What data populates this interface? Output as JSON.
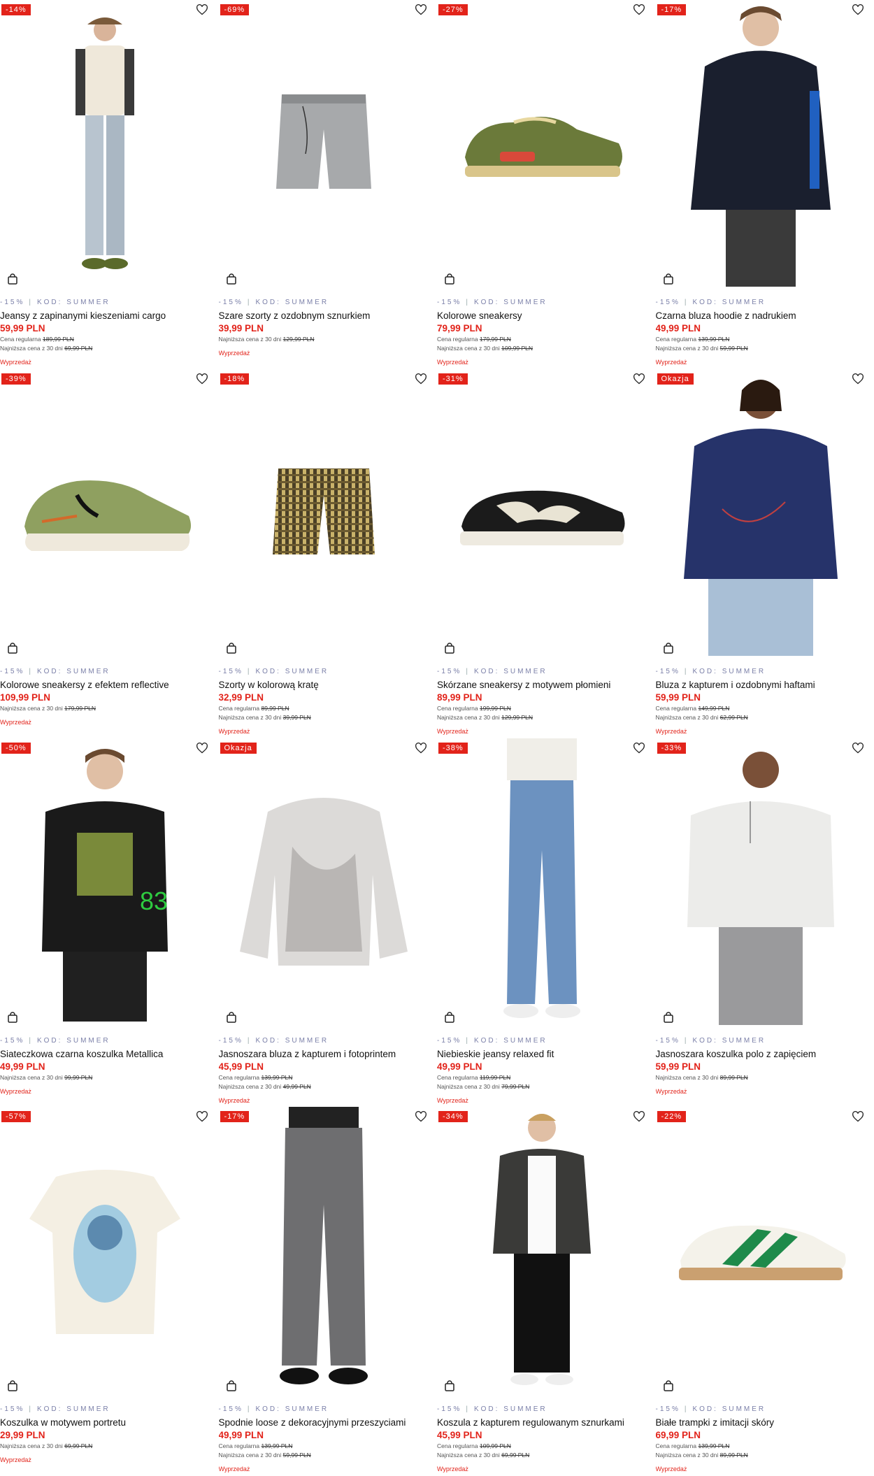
{
  "colors": {
    "accent": "#e2231a",
    "promo": "#7a7fa8"
  },
  "promo": {
    "discount": "-15%",
    "code": "KOD: SUMMER"
  },
  "sale_label": "Wyprzedaż",
  "products": [
    {
      "badge": "-14%",
      "name": "Jeansy z zapinanymi kieszeniami cargo",
      "price": "59,99 PLN",
      "regular_label": "Cena regularna",
      "regular": "189,99 PLN",
      "lowest_label": "Najniższa cena z 30 dni",
      "lowest": "69,99 PLN"
    },
    {
      "badge": "-69%",
      "name": "Szare szorty z ozdobnym sznurkiem",
      "price": "39,99 PLN",
      "regular_label": "",
      "regular": "",
      "lowest_label": "Najniższa cena z 30 dni",
      "lowest": "129,99 PLN"
    },
    {
      "badge": "-27%",
      "name": "Kolorowe sneakersy",
      "price": "79,99 PLN",
      "regular_label": "Cena regularna",
      "regular": "179,99 PLN",
      "lowest_label": "Najniższa cena z 30 dni",
      "lowest": "109,99 PLN"
    },
    {
      "badge": "-17%",
      "name": "Czarna bluza hoodie z nadrukiem",
      "price": "49,99 PLN",
      "regular_label": "Cena regularna",
      "regular": "139,99 PLN",
      "lowest_label": "Najniższa cena z 30 dni",
      "lowest": "59,99 PLN"
    },
    {
      "badge": "-39%",
      "name": "Kolorowe sneakersy z efektem reflective",
      "price": "109,99 PLN",
      "regular_label": "",
      "regular": "",
      "lowest_label": "Najniższa cena z 30 dni",
      "lowest": "179,99 PLN"
    },
    {
      "badge": "-18%",
      "name": "Szorty w kolorową kratę",
      "price": "32,99 PLN",
      "regular_label": "Cena regularna",
      "regular": "89,99 PLN",
      "lowest_label": "Najniższa cena z 30 dni",
      "lowest": "39,99 PLN"
    },
    {
      "badge": "-31%",
      "name": "Skórzane sneakersy z motywem płomieni",
      "price": "89,99 PLN",
      "regular_label": "Cena regularna",
      "regular": "199,99 PLN",
      "lowest_label": "Najniższa cena z 30 dni",
      "lowest": "129,99 PLN"
    },
    {
      "badge": "Okazja",
      "name": "Bluza z kapturem i ozdobnymi haftami",
      "price": "59,99 PLN",
      "regular_label": "Cena regularna",
      "regular": "149,99 PLN",
      "lowest_label": "Najniższa cena z 30 dni",
      "lowest": "62,99 PLN"
    },
    {
      "badge": "-50%",
      "name": "Siateczkowa czarna koszulka Metallica",
      "price": "49,99 PLN",
      "regular_label": "",
      "regular": "",
      "lowest_label": "Najniższa cena z 30 dni",
      "lowest": "99,99 PLN"
    },
    {
      "badge": "Okazja",
      "name": "Jasnoszara bluza z kapturem i fotoprintem",
      "price": "45,99 PLN",
      "regular_label": "Cena regularna",
      "regular": "139,99 PLN",
      "lowest_label": "Najniższa cena z 30 dni",
      "lowest": "49,99 PLN"
    },
    {
      "badge": "-38%",
      "name": "Niebieskie jeansy relaxed fit",
      "price": "49,99 PLN",
      "regular_label": "Cena regularna",
      "regular": "119,99 PLN",
      "lowest_label": "Najniższa cena z 30 dni",
      "lowest": "79,99 PLN"
    },
    {
      "badge": "-33%",
      "name": "Jasnoszara koszulka polo z zapięciem",
      "price": "59,99 PLN",
      "regular_label": "",
      "regular": "",
      "lowest_label": "Najniższa cena z 30 dni",
      "lowest": "89,99 PLN"
    },
    {
      "badge": "-57%",
      "name": "Koszulka w motywem portretu",
      "price": "29,99 PLN",
      "regular_label": "",
      "regular": "",
      "lowest_label": "Najniższa cena z 30 dni",
      "lowest": "69,99 PLN"
    },
    {
      "badge": "-17%",
      "name": "Spodnie loose z dekoracyjnymi przeszyciami",
      "price": "49,99 PLN",
      "regular_label": "Cena regularna",
      "regular": "139,99 PLN",
      "lowest_label": "Najniższa cena z 30 dni",
      "lowest": "59,99 PLN"
    },
    {
      "badge": "-34%",
      "name": "Koszula z kapturem regulowanym sznurkami",
      "price": "45,99 PLN",
      "regular_label": "Cena regularna",
      "regular": "109,99 PLN",
      "lowest_label": "Najniższa cena z 30 dni",
      "lowest": "69,99 PLN"
    },
    {
      "badge": "-22%",
      "name": "Białe trampki z imitacji skóry",
      "price": "69,99 PLN",
      "regular_label": "Cena regularna",
      "regular": "139,99 PLN",
      "lowest_label": "Najniższa cena z 30 dni",
      "lowest": "89,99 PLN"
    }
  ]
}
